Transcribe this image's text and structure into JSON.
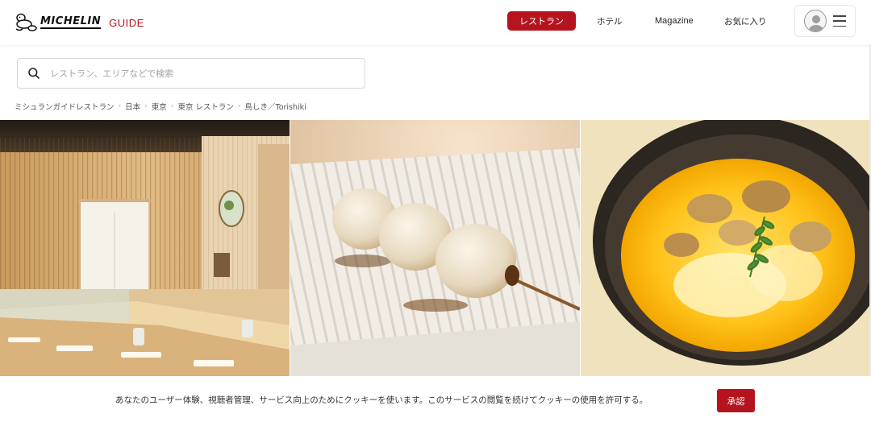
{
  "header": {
    "logo_wordmark": "MICHELIN",
    "logo_guide": "GUIDE",
    "nav": {
      "restaurants": "レストラン",
      "hotels": "ホテル",
      "magazine": "Magazine",
      "favorites": "お気に入り"
    },
    "accent_color": "#b5141e"
  },
  "search": {
    "placeholder": "レストラン、エリアなどで検索",
    "value": ""
  },
  "breadcrumb": [
    "ミシュランガイドレストラン",
    "日本",
    "東京",
    "東京 レストラン",
    "鳥しき／Torishiki"
  ],
  "gallery": {
    "images": [
      "restaurant-interior-photo",
      "quail-egg-skewer-photo",
      "oyakodon-photo"
    ]
  },
  "cookie": {
    "message": "あなたのユーザー体験、視聴者管理、サービス向上のためにクッキーを使います。このサービスの閲覧を続けてクッキーの使用を許可する。",
    "accept_label": "承認"
  }
}
